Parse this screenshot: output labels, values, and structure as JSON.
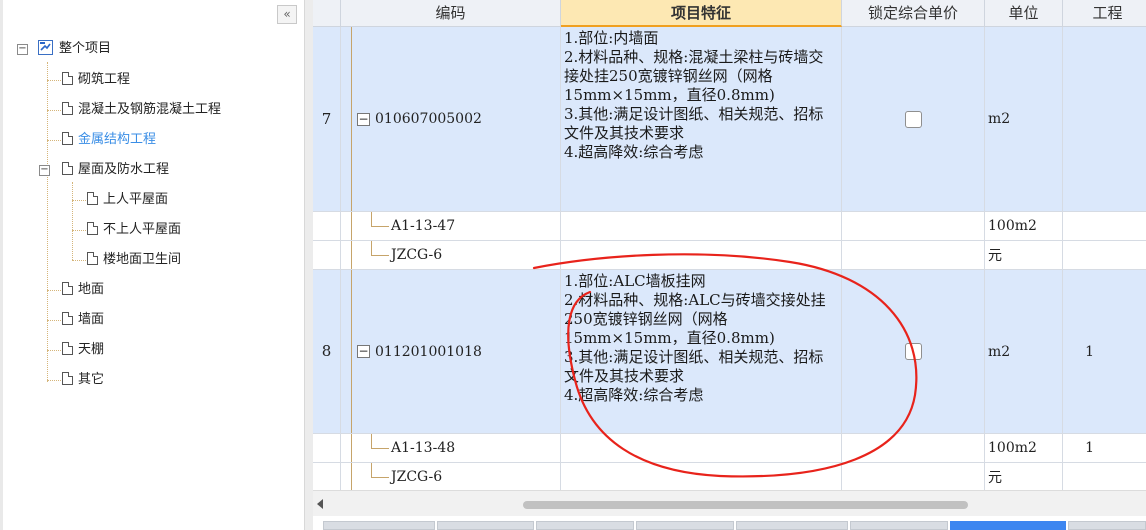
{
  "tree": {
    "collapse_label": "«",
    "root": "整个项目",
    "items": [
      {
        "label": "砌筑工程"
      },
      {
        "label": "混凝土及钢筋混凝土工程"
      },
      {
        "label": "金属结构工程"
      },
      {
        "label": "屋面及防水工程"
      },
      {
        "label": "上人平屋面"
      },
      {
        "label": "不上人平屋面"
      },
      {
        "label": "楼地面卫生间"
      },
      {
        "label": "地面"
      },
      {
        "label": "墙面"
      },
      {
        "label": "天棚"
      },
      {
        "label": "其它"
      }
    ],
    "expander_minus": "⊟"
  },
  "grid": {
    "headers": {
      "code": "编码",
      "features": "项目特征",
      "lock": "锁定综合单价",
      "unit": "单位",
      "qty": "工程"
    },
    "rows": [
      {
        "num": "7",
        "code": "010607005002",
        "features": "1.部位:内墙面\n2.材料品种、规格:混凝土梁柱与砖墙交接处挂250宽镀锌钢丝网（网格15mm×15mm，直径0.8mm)\n3.其他:满足设计图纸、相关规范、招标文件及其技术要求\n4.超高降效:综合考虑",
        "unit": "m2",
        "qty": ""
      },
      {
        "code": "A1-13-47",
        "unit": "100m2",
        "qty": ""
      },
      {
        "code": "JZCG-6",
        "unit": "元",
        "qty": ""
      },
      {
        "num": "8",
        "code": "011201001018",
        "features": "1.部位:ALC墙板挂网\n2.材料品种、规格:ALC与砖墙交接处挂250宽镀锌钢丝网（网格15mm×15mm，直径0.8mm)\n3.其他:满足设计图纸、相关规范、招标文件及其技术要求\n4.超高降效:综合考虑",
        "unit": "m2",
        "qty": "1"
      },
      {
        "code": "A1-13-48",
        "unit": "100m2",
        "qty": "1"
      },
      {
        "code": "JZCG-6",
        "unit": "元",
        "qty": ""
      }
    ]
  },
  "colors": {
    "header_bg": "#eef1f6",
    "active_header_bg": "#fde8b3",
    "row_selected_bg": "#dbe8fb",
    "tree_active": "#3a8ee6",
    "annotation": "#e8231b"
  }
}
